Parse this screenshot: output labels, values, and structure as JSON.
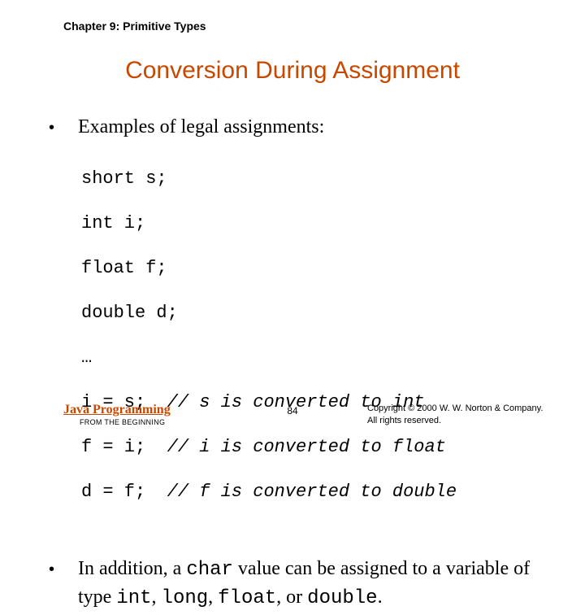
{
  "chapter": "Chapter 9: Primitive Types",
  "title": "Conversion During Assignment",
  "bullets": {
    "b1": "Examples of legal assignments:",
    "b2_pre": "In addition, a ",
    "b2_code1": "char",
    "b2_mid": " value can be assigned to a variable of type ",
    "b2_code2": "int",
    "b2_sep1": ", ",
    "b2_code3": "long",
    "b2_sep2": ", ",
    "b2_code4": "float",
    "b2_sep3": ", or ",
    "b2_code5": "double",
    "b2_end": "."
  },
  "code": {
    "l1": "short s;",
    "l2": "int i;",
    "l3": "float f;",
    "l4": "double d;",
    "l5": "…",
    "l6a": "i = s;  ",
    "l6b": "// s is converted to int",
    "l7a": "f = i;  ",
    "l7b": "// i is converted to float",
    "l8a": "d = f;  ",
    "l8b": "// f is converted to double"
  },
  "footer": {
    "brand": "Java Programming",
    "subbrand": "FROM THE BEGINNING",
    "page": "84",
    "copyright1": "Copyright © 2000 W. W. Norton & Company.",
    "copyright2": "All rights reserved."
  }
}
